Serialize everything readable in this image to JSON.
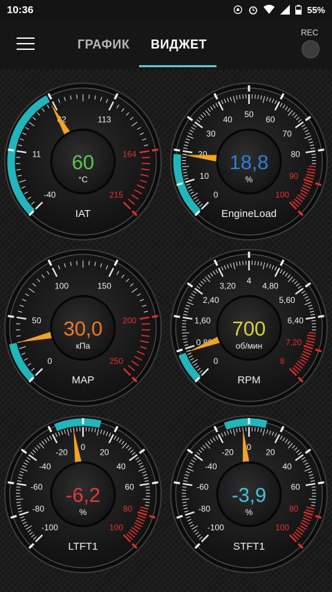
{
  "status": {
    "time": "10:36",
    "battery": "55%"
  },
  "appbar": {
    "tab_graph": "ГРАФИК",
    "tab_widget": "ВИДЖЕТ",
    "rec": "REC"
  },
  "colors": {
    "accent": "#22b5bb",
    "red": "#e23030"
  },
  "gauges": [
    {
      "id": "iat",
      "min": -40,
      "max": 215,
      "ticks": [
        -40,
        11,
        62,
        113,
        164,
        215
      ],
      "tick_labels": [
        "-40",
        "11",
        "62",
        "113",
        "164",
        "215"
      ],
      "red_from": 164,
      "value": 60,
      "value_text": "60",
      "unit": "°C",
      "label": "IAT",
      "value_color": "#58c84a",
      "teal_from": -40,
      "teal_to": 60
    },
    {
      "id": "load",
      "min": 0,
      "max": 100,
      "ticks": [
        0,
        10,
        20,
        30,
        40,
        50,
        60,
        70,
        80,
        90,
        100
      ],
      "tick_labels": [
        "0",
        "10",
        "20",
        "30",
        "40",
        "50",
        "60",
        "70",
        "80",
        "90",
        "100"
      ],
      "red_from": 85,
      "value": 18.8,
      "value_text": "18,8",
      "unit": "%",
      "label": "EngineLoad",
      "value_color": "#2d7fd6",
      "teal_from": 0,
      "teal_to": 18.8
    },
    {
      "id": "map",
      "min": 0,
      "max": 250,
      "ticks": [
        0,
        50,
        100,
        150,
        200,
        250
      ],
      "tick_labels": [
        "0",
        "50",
        "100",
        "150",
        "200",
        "250"
      ],
      "red_from": 200,
      "value": 30,
      "value_text": "30,0",
      "unit": "кПа",
      "label": "MAP",
      "value_color": "#f07a21",
      "teal_from": 0,
      "teal_to": 30
    },
    {
      "id": "rpm",
      "min": 0,
      "max": 8,
      "ticks": [
        0,
        0.8,
        1.6,
        2.4,
        3.2,
        4,
        4.8,
        5.6,
        6.4,
        7.2,
        8
      ],
      "tick_labels": [
        "0",
        "0,80",
        "1,60",
        "2,40",
        "3,20",
        "4",
        "4,80",
        "5,60",
        "6,40",
        "7,20",
        "8"
      ],
      "red_from": 6.8,
      "value": 0.7,
      "value_text": "700",
      "unit": "об/мин",
      "label": "RPM",
      "value_color": "#d6d23b",
      "teal_from": 0,
      "teal_to": 0.7
    },
    {
      "id": "ltft",
      "min": -100,
      "max": 100,
      "ticks": [
        -100,
        -80,
        -60,
        -40,
        -20,
        0,
        20,
        40,
        60,
        80,
        100
      ],
      "tick_labels": [
        "-100",
        "-80",
        "-60",
        "-40",
        "-20",
        "0",
        "20",
        "40",
        "60",
        "80",
        "100"
      ],
      "red_from": 75,
      "value": -6.2,
      "value_text": "-6,2",
      "unit": "%",
      "label": "LTFT1",
      "value_color": "#e23a3a",
      "teal_from": -6.2,
      "teal_to": 0
    },
    {
      "id": "stft",
      "min": -100,
      "max": 100,
      "ticks": [
        -100,
        -80,
        -60,
        -40,
        -20,
        0,
        20,
        40,
        60,
        80,
        100
      ],
      "tick_labels": [
        "-100",
        "-80",
        "-60",
        "-40",
        "-20",
        "0",
        "20",
        "40",
        "60",
        "80",
        "100"
      ],
      "red_from": 75,
      "value": -3.9,
      "value_text": "-3,9",
      "unit": "%",
      "label": "STFT1",
      "value_color": "#3ec4d6",
      "teal_from": -3.9,
      "teal_to": 0
    }
  ]
}
